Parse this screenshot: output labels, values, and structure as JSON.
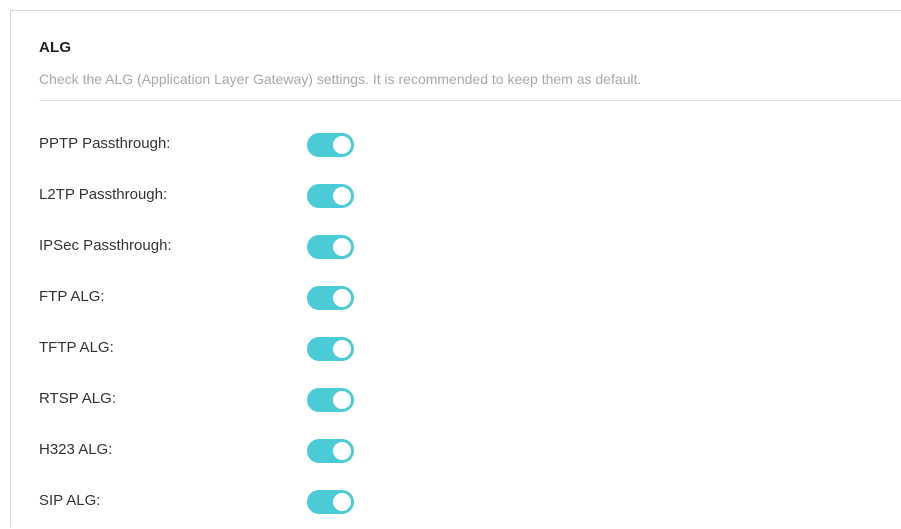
{
  "section": {
    "title": "ALG",
    "description": "Check the ALG (Application Layer Gateway) settings. It is recommended to keep them as default."
  },
  "colors": {
    "toggle_on": "#4acbd6",
    "toggle_knob": "#ffffff",
    "description_text": "#a8a8a8"
  },
  "settings": [
    {
      "label": "PPTP Passthrough:",
      "enabled": true
    },
    {
      "label": "L2TP Passthrough:",
      "enabled": true
    },
    {
      "label": "IPSec Passthrough:",
      "enabled": true
    },
    {
      "label": "FTP ALG:",
      "enabled": true
    },
    {
      "label": "TFTP ALG:",
      "enabled": true
    },
    {
      "label": "RTSP ALG:",
      "enabled": true
    },
    {
      "label": "H323 ALG:",
      "enabled": true
    },
    {
      "label": "SIP ALG:",
      "enabled": true
    }
  ]
}
